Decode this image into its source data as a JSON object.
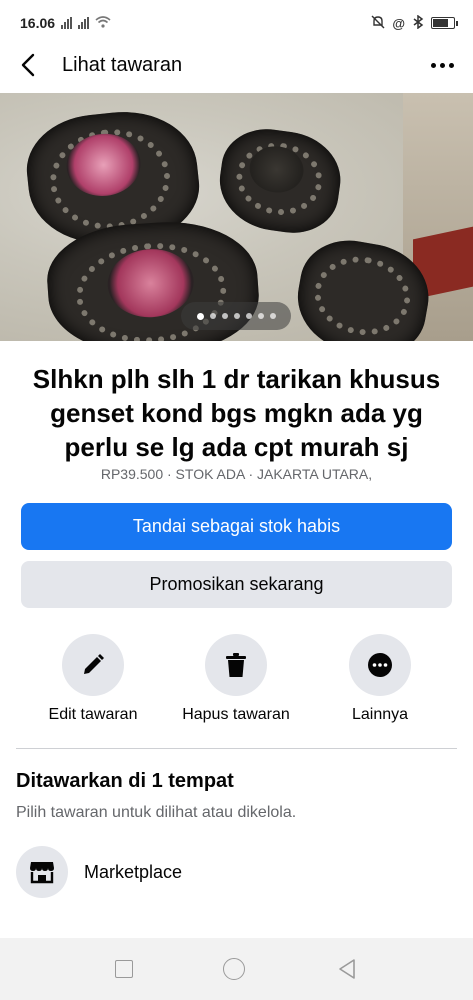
{
  "status_bar": {
    "time": "16.06",
    "battery_level": 0.8
  },
  "header": {
    "title": "Lihat tawaran"
  },
  "gallery": {
    "photo_count": 7,
    "current_index": 1
  },
  "listing": {
    "title": "Slhkn plh slh 1 dr tarikan khusus genset kond bgs mgkn ada yg perlu se lg ada cpt murah sj",
    "meta": "RP39.500 · STOK ADA · JAKARTA UTARA,"
  },
  "buttons": {
    "primary_label": "Tandai sebagai stok habis",
    "secondary_label": "Promosikan sekarang"
  },
  "actions": {
    "edit_label": "Edit tawaran",
    "delete_label": "Hapus tawaran",
    "more_label": "Lainnya"
  },
  "offered_section": {
    "title": "Ditawarkan di 1 tempat",
    "subtitle": "Pilih tawaran untuk dilihat atau dikelola.",
    "places": [
      {
        "label": "Marketplace",
        "icon": "store-icon"
      }
    ]
  },
  "colors": {
    "accent": "#1877f2",
    "button_gray": "#e4e6eb",
    "secondary_text": "#65676b"
  }
}
